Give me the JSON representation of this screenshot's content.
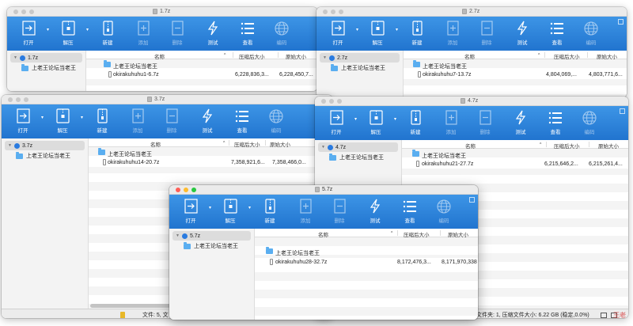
{
  "toolbar": {
    "open": "打开",
    "extract": "解压",
    "new": "新建",
    "add": "添加",
    "delete": "删除",
    "test": "测试",
    "view": "查看",
    "encode": "编码"
  },
  "columns": {
    "name": "名称",
    "compressed": "压缩后大小",
    "original": "原始大小"
  },
  "folder_label": "上老王论坛当老王",
  "windows": {
    "w1": {
      "title": "1.7z",
      "archive": "1.7z",
      "file": "okirakuhuhu1-6.7z",
      "compressed": "6,228,836,3...",
      "original": "6,228,450,7..."
    },
    "w2": {
      "title": "2.7z",
      "archive": "2.7z",
      "file": "okirakuhuhu7-13.7z",
      "compressed": "4,804,069,...",
      "original": "4,803,771,6..."
    },
    "w3": {
      "title": "3.7z",
      "archive": "3.7z",
      "file": "okirakuhuhu14-20.7z",
      "compressed": "7,358,921,6...",
      "original": "7,358,466,0..."
    },
    "w4": {
      "title": "4.7z",
      "archive": "4.7z",
      "file": "okirakuhuhu21-27.7z",
      "compressed": "6,215,646,2...",
      "original": "6,215,261,4..."
    },
    "w5": {
      "title": "5.7z",
      "archive": "5.7z",
      "file": "okirakuhuhu28-32.7z",
      "compressed": "8,172,476,3...",
      "original": "8,171,970,338"
    }
  },
  "status_left": "文件: 5, 文",
  "status_right": "文件夹: 1, 压缩文件大小: 6.22 GB (稳定,0.0%)",
  "watermark": "王老"
}
